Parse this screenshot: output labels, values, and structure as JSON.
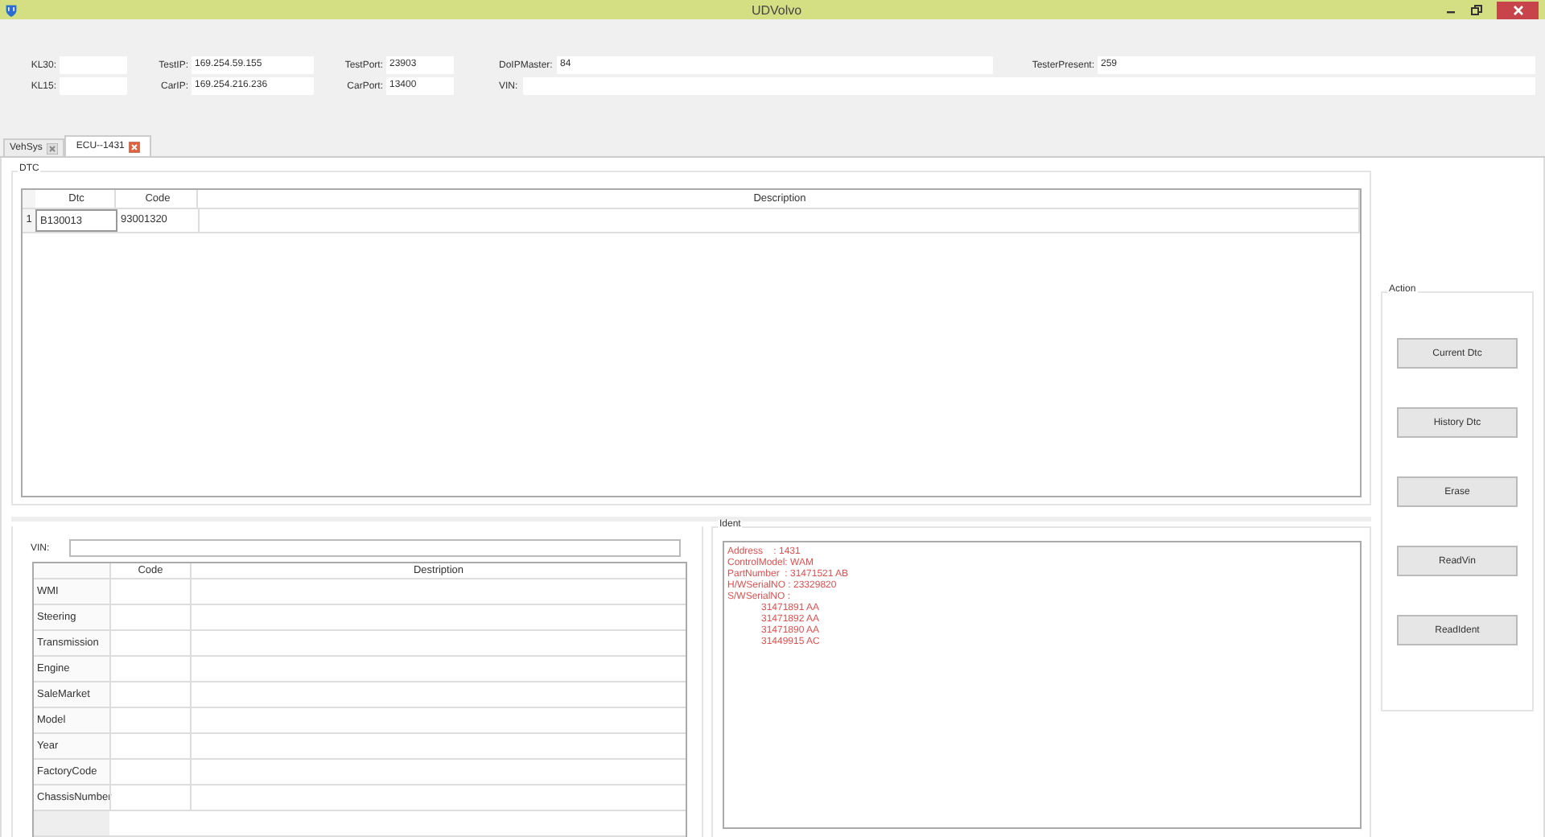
{
  "window": {
    "title": "UDVolvo"
  },
  "header_fields": [
    {
      "label": "KL30:"
    },
    {
      "label": "TestIP:",
      "value": "169.254.59.155"
    },
    {
      "label": "TestPort:",
      "value": "23903"
    },
    {
      "label": "DoIPMaster:",
      "value": "84"
    },
    {
      "label": "TesterPresent:",
      "value": "259"
    },
    {
      "label": "KL15:"
    },
    {
      "label": "CarIP:",
      "value": "169.254.216.236"
    },
    {
      "label": "CarPort:",
      "value": "13400"
    },
    {
      "label": "VIN:"
    }
  ],
  "tabs": [
    {
      "label": "VehSys",
      "selected": false
    },
    {
      "label": "ECU--1431",
      "selected": true
    }
  ],
  "dtc": {
    "title": "DTC",
    "columns": [
      "Dtc",
      "Code",
      "Description"
    ],
    "rows": [
      {
        "index": "1",
        "cells": [
          "B130013",
          "93001320"
        ]
      }
    ]
  },
  "vin": {
    "label": "VIN:",
    "columns": [
      "Code",
      "Destription"
    ],
    "rows": [
      "WMI",
      "Steering",
      "Transmission",
      "Engine",
      "SaleMarket",
      "Model",
      "Year",
      "FactoryCode",
      "ChassisNumber"
    ]
  },
  "ident": {
    "title": "Ident",
    "lines": [
      {
        "kind": "field",
        "text": "Address    : 1431"
      },
      {
        "kind": "field",
        "text": "ControlModel: WAM"
      },
      {
        "kind": "field",
        "text": "PartNumber  : 31471521 AB"
      },
      {
        "kind": "field",
        "text": "H/WSerialNO : 23329820"
      },
      {
        "kind": "field",
        "text": "S/WSerialNO :"
      },
      {
        "kind": "value",
        "text": "31471891 AA"
      },
      {
        "kind": "value",
        "text": "31471892 AA"
      },
      {
        "kind": "value",
        "text": "31471890 AA"
      },
      {
        "kind": "value",
        "text": "31449915 AC"
      }
    ]
  },
  "action": {
    "title": "Action",
    "buttons": [
      "Current Dtc",
      "History Dtc",
      "Erase",
      "ReadVin",
      "ReadIdent"
    ]
  }
}
